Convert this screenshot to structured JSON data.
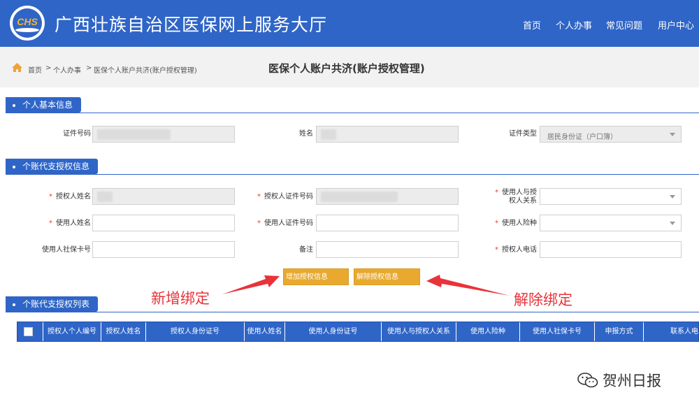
{
  "header": {
    "logo_text": "CHS",
    "title": "广西壮族自治区医保网上服务大厅",
    "nav": [
      "首页",
      "个人办事",
      "常见问题",
      "用户中心"
    ]
  },
  "breadcrumb": {
    "items": [
      "首页",
      "个人办事",
      "医保个人账户共济(账户授权管理)"
    ],
    "separator": ">"
  },
  "page_title": "医保个人账户共济(账户授权管理)",
  "section_basic": {
    "title": "个人基本信息",
    "id_number_label": "证件号码",
    "name_label": "姓名",
    "id_type_label": "证件类型",
    "id_type_value": "居民身份证（户口簿）"
  },
  "section_auth": {
    "title": "个账代支授权信息",
    "authorizer_name_label": "授权人姓名",
    "authorizer_id_label": "授权人证件号码",
    "relation_label": "使用人与授权人关系",
    "user_name_label": "使用人姓名",
    "user_id_label": "使用人证件号码",
    "user_insurance_label": "使用人险种",
    "user_card_label": "使用人社保卡号",
    "remark_label": "备注",
    "authorizer_phone_label": "授权人电话",
    "required_mark": "*"
  },
  "buttons": {
    "add": "增加授权信息",
    "remove": "解除授权信息"
  },
  "annotations": {
    "add": "新增绑定",
    "remove": "解除绑定"
  },
  "section_list": {
    "title": "个账代支授权列表",
    "columns": [
      "授权人个人编号",
      "授权人姓名",
      "授权人身份证号",
      "使用人姓名",
      "使用人身份证号",
      "使用人与授权人关系",
      "使用人险种",
      "使用人社保卡号",
      "申报方式",
      "联系人电"
    ]
  },
  "watermark": "贺州日报",
  "colors": {
    "brand": "#2f65c7",
    "button": "#e8a92e",
    "annotation": "#e8333a"
  }
}
